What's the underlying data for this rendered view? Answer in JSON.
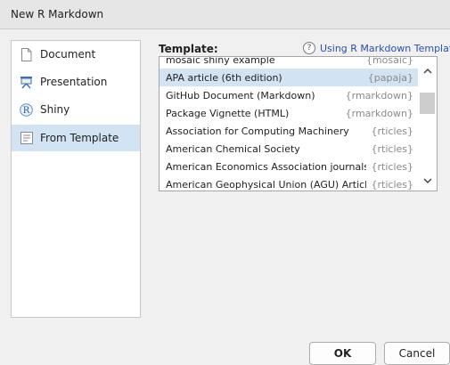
{
  "window": {
    "title": "New R Markdown"
  },
  "sidebar": {
    "items": [
      {
        "label": "Document",
        "icon": "document-icon",
        "selected": false
      },
      {
        "label": "Presentation",
        "icon": "presentation-icon",
        "selected": false
      },
      {
        "label": "Shiny",
        "icon": "shiny-r-icon",
        "selected": false
      },
      {
        "label": "From Template",
        "icon": "template-icon",
        "selected": true
      }
    ]
  },
  "template": {
    "header": "Template:",
    "help_link": "Using R Markdown Templates",
    "help_icon_glyph": "?",
    "rows": [
      {
        "name": "mosaic shiny example",
        "pkg": "{mosaic}",
        "selected": false
      },
      {
        "name": "APA article (6th edition)",
        "pkg": "{papaja}",
        "selected": true
      },
      {
        "name": "GitHub Document (Markdown)",
        "pkg": "{rmarkdown}",
        "selected": false
      },
      {
        "name": "Package Vignette (HTML)",
        "pkg": "{rmarkdown}",
        "selected": false
      },
      {
        "name": "Association for Computing Machinery",
        "pkg": "{rticles}",
        "selected": false
      },
      {
        "name": "American Chemical Society",
        "pkg": "{rticles}",
        "selected": false
      },
      {
        "name": "American Economics Association journals",
        "pkg": "{rticles}",
        "selected": false
      },
      {
        "name": "American Geophysical Union (AGU) Article",
        "pkg": "{rticles}",
        "selected": false
      }
    ]
  },
  "buttons": {
    "ok": "OK",
    "cancel": "Cancel"
  },
  "colors": {
    "selection": "#d2e3f3",
    "link": "#2850a8",
    "package_text": "#8a8a8a"
  }
}
